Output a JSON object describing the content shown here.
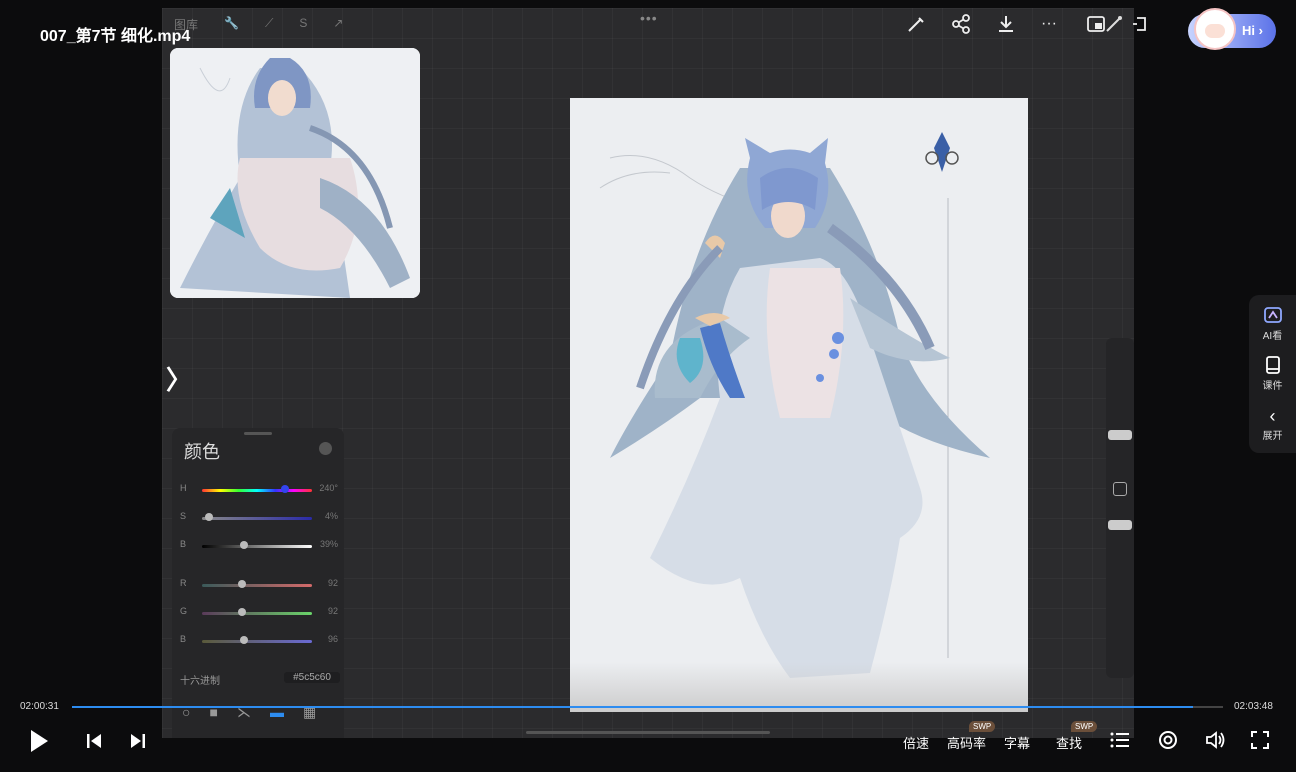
{
  "player": {
    "file_title": "007_第7节 细化.mp4",
    "hi_label": "Hi ›",
    "time_current": "02:00:31",
    "time_total": "02:03:48",
    "progress": 0.974,
    "controls": {
      "speed": "倍速",
      "quality": "高码率",
      "subtitle": "字幕",
      "search": "查找",
      "swp_badge_1": "SWP",
      "swp_badge_2": "SWP"
    },
    "side_panel": {
      "ai": "AI看",
      "courseware": "课件",
      "expand": "展开"
    }
  },
  "app": {
    "toolbar_left": [
      "图库",
      "🔧",
      "⟋",
      "S",
      "↗"
    ],
    "color_panel": {
      "title": "颜色",
      "sliders": [
        {
          "label": "H",
          "value": "240°",
          "pos": 0.72
        },
        {
          "label": "S",
          "value": "4%",
          "pos": 0.03
        },
        {
          "label": "B",
          "value": "39%",
          "pos": 0.38
        },
        {
          "label": "R",
          "value": "92",
          "pos": 0.36
        },
        {
          "label": "G",
          "value": "92",
          "pos": 0.36
        },
        {
          "label": "B",
          "value": "96",
          "pos": 0.38
        }
      ],
      "hex_label": "十六进制",
      "hex_value": "#5c5c60"
    }
  }
}
